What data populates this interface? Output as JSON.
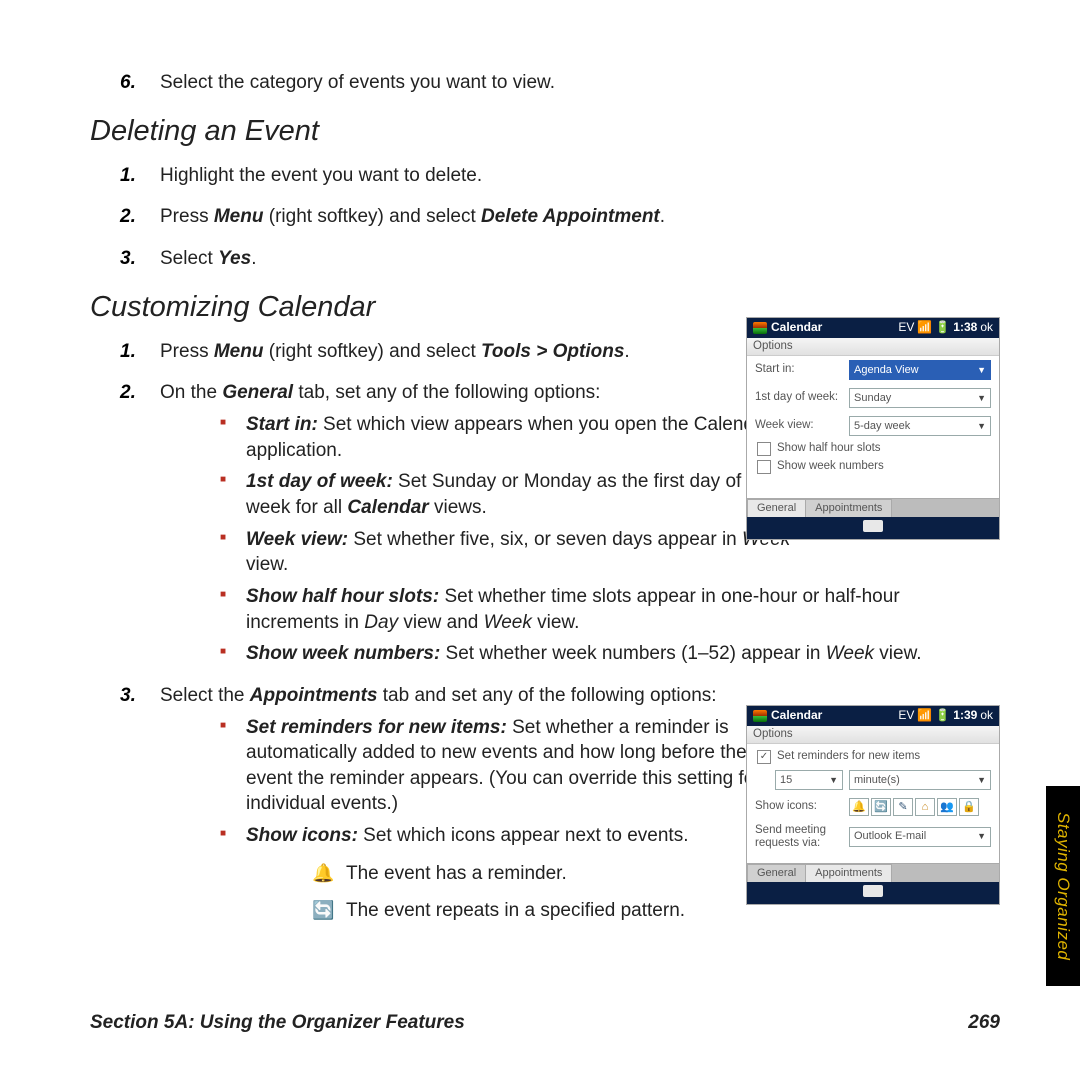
{
  "step6": {
    "num": "6.",
    "text": "Select the category of events you want to view."
  },
  "deleting": {
    "title": "Deleting an Event",
    "items": [
      {
        "num": "1.",
        "text": "Highlight the event you want to delete."
      },
      {
        "num": "2.",
        "pre": "Press ",
        "b1": "Menu",
        "mid": " (right softkey) and select ",
        "b2": "Delete Appointment",
        "post": "."
      },
      {
        "num": "3.",
        "pre": "Select ",
        "b1": "Yes",
        "post": "."
      }
    ]
  },
  "customizing": {
    "title": "Customizing Calendar",
    "s1": {
      "num": "1.",
      "pre": "Press ",
      "b1": "Menu",
      "mid": " (right softkey) and select ",
      "b2": "Tools > Options",
      "post": "."
    },
    "s2": {
      "num": "2.",
      "pre": "On the ",
      "b1": "General",
      "post": " tab, set any of the following options:"
    },
    "opts1": [
      {
        "b": "Start in:",
        "t": " Set which view appears when you open the Calendar application."
      },
      {
        "b": "1st day of week:",
        "t1": " Set Sunday or Monday as the first day of the week for all ",
        "bi": "Calendar",
        "t2": " views."
      },
      {
        "b": "Week view:",
        "t1": " Set whether five, six, or seven days appear in ",
        "i": "Week",
        "t2": " view."
      },
      {
        "b": "Show half hour slots:",
        "t1": " Set whether time slots appear in one-hour or half-hour increments in ",
        "i1": "Day",
        "mid": " view and ",
        "i2": "Week",
        "t2": " view."
      },
      {
        "b": "Show week numbers:",
        "t1": " Set whether week numbers (1–52) appear in ",
        "i": "Week",
        "t2": " view."
      }
    ],
    "s3": {
      "num": "3.",
      "pre": "Select the ",
      "b1": "Appointments",
      "post": " tab and set any of the following options:"
    },
    "opts2": [
      {
        "b": "Set reminders for new items:",
        "t": " Set whether a reminder is automatically added to new events and how long before the event the reminder appears. (You can override this setting for individual events.)"
      },
      {
        "b": "Show icons:",
        "t": " Set which icons appear next to events."
      }
    ],
    "iconlines": [
      {
        "icon": "🔔",
        "cls": "bell",
        "text": "The event has a reminder."
      },
      {
        "icon": "🔄",
        "cls": "cycle",
        "text": "The event repeats in a specified pattern."
      }
    ]
  },
  "shot1": {
    "title": "Calendar",
    "time": "1:38",
    "ok": "ok",
    "ev": "EV",
    "subtitle": "Options",
    "rows": {
      "r1l": "Start in:",
      "r1v": "Agenda View",
      "r2l": "1st day of week:",
      "r2v": "Sunday",
      "r3l": "Week view:",
      "r3v": "5-day week"
    },
    "chk1": "Show half hour slots",
    "chk2": "Show week numbers",
    "tab1": "General",
    "tab2": "Appointments"
  },
  "shot2": {
    "title": "Calendar",
    "time": "1:39",
    "ok": "ok",
    "ev": "EV",
    "subtitle": "Options",
    "chk": "Set reminders for new items",
    "num": "15",
    "unit": "minute(s)",
    "showicons": "Show icons:",
    "sendreq": "Send meeting requests via:",
    "sendval": "Outlook E-mail",
    "tab1": "General",
    "tab2": "Appointments",
    "icons": [
      "🔔",
      "🔄",
      "✎",
      "⌂",
      "👥",
      "🔒"
    ]
  },
  "sidetab": "Staying Organized",
  "footer": {
    "left": "Section 5A: Using the Organizer Features",
    "right": "269"
  }
}
